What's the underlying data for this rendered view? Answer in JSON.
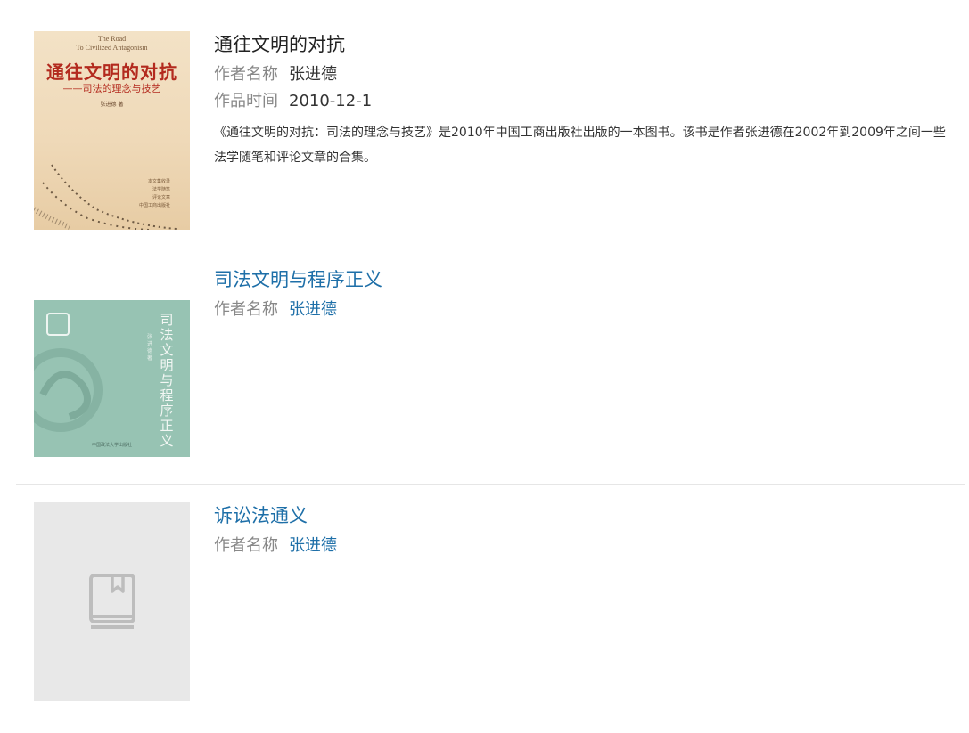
{
  "books": [
    {
      "title": "通往文明的对抗",
      "author_label": "作者名称",
      "author": "张进德",
      "date_label": "作品时间",
      "date": "2010-12-1",
      "description": "《通往文明的对抗：司法的理念与技艺》是2010年中国工商出版社出版的一本图书。该书是作者张进德在2002年到2009年之间一些法学随笔和评论文章的合集。",
      "cover": {
        "en_line1": "The Road",
        "en_line2": "To Civilized Antagonism",
        "title": "通往文明的对抗",
        "subtitle": "——司法的理念与技艺",
        "author": "张进德 著",
        "note1": "本文集收录",
        "note2": "法学随笔",
        "note3": "评论文章",
        "note4": "中国工商出版社"
      }
    },
    {
      "title": "司法文明与程序正义",
      "author_label": "作者名称",
      "author": "张进德",
      "cover": {
        "title": "司法文明与程序正义",
        "author": "张进德著",
        "publisher": "中国政法大学出版社"
      }
    },
    {
      "title": "诉讼法通义",
      "author_label": "作者名称",
      "author": "张进德",
      "cover": {
        "placeholder_icon": "book-icon"
      }
    }
  ],
  "colors": {
    "link": "#1e6fa8",
    "label": "#888888",
    "divider": "#e6e6e6",
    "placeholder": "#e8e8e8"
  }
}
